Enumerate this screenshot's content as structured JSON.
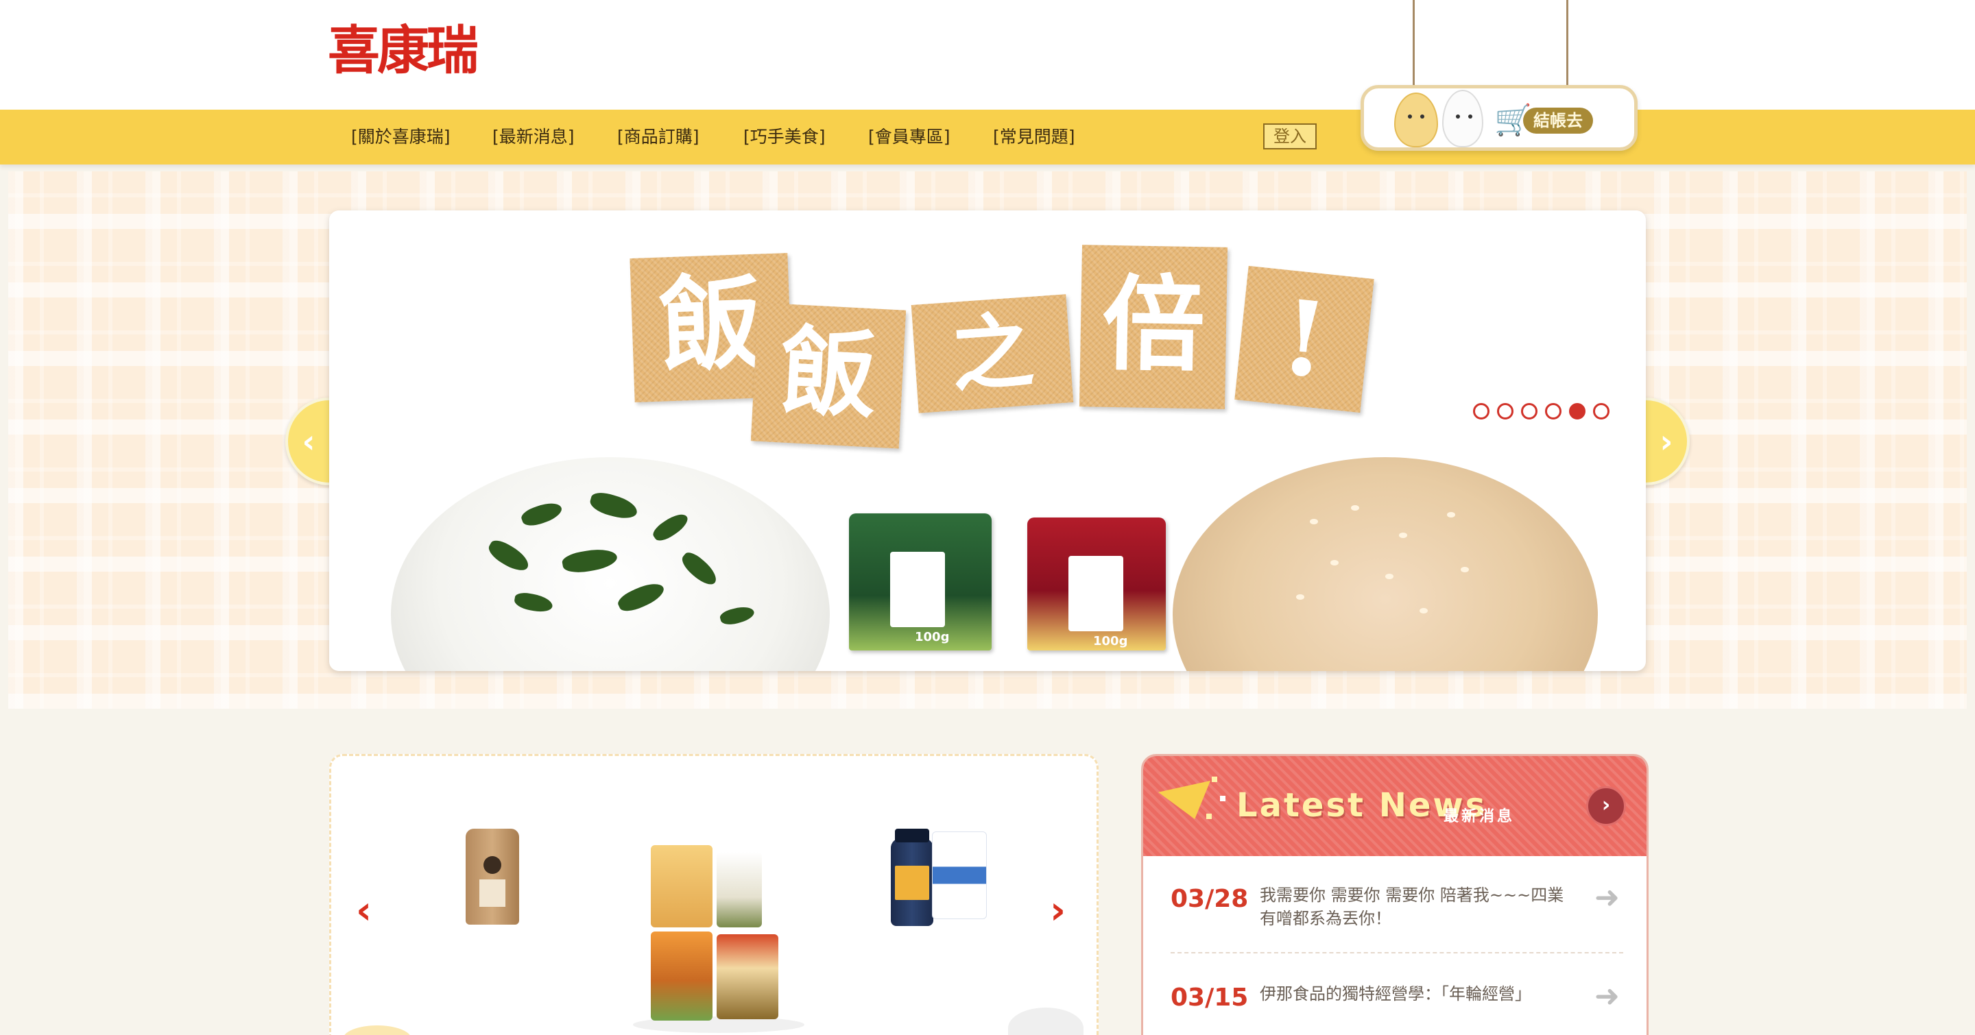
{
  "brand": {
    "logo_text": "喜康瑞"
  },
  "nav": {
    "items": [
      {
        "label": "[關於喜康瑞]"
      },
      {
        "label": "[最新消息]"
      },
      {
        "label": "[商品訂購]"
      },
      {
        "label": "[巧手美食]"
      },
      {
        "label": "[會員專區]"
      },
      {
        "label": "[常見問題]"
      }
    ],
    "login_label": "登入",
    "checkout_label": "結帳去"
  },
  "hero": {
    "headline_chars": [
      "飯",
      "飯",
      "之",
      "倍",
      "!"
    ],
    "pack_weight_1": "100g",
    "pack_weight_2": "100g",
    "slide_count": 6,
    "active_slide": 5,
    "prev_icon": "chevron-left-icon",
    "next_icon": "chevron-right-icon"
  },
  "products": {
    "prev_icon": "chevron-left-icon",
    "next_icon": "chevron-right-icon"
  },
  "news": {
    "title": "Latest News",
    "subtitle": "最新消息",
    "items": [
      {
        "date": "03/28",
        "text": "我需要你 需要你 需要你 陪著我~~~四業有噌都系為丟你！"
      },
      {
        "date": "03/15",
        "text": "伊那食品的獨特經營學：「年輪經營」"
      }
    ]
  },
  "colors": {
    "nav_yellow": "#f8d04c",
    "brand_red": "#d7261c",
    "news_red": "#ec6b62",
    "date_red": "#d43a27",
    "dot_red": "#d1332a"
  }
}
